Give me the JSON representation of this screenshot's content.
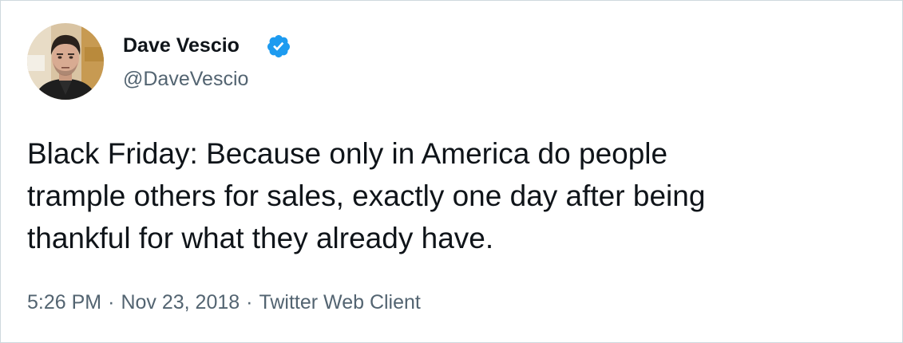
{
  "author": {
    "display_name": "Dave Vescio",
    "handle": "@DaveVescio",
    "verified": true,
    "verified_icon": "verified-badge-icon",
    "verified_color": "#1d9bf0"
  },
  "tweet": {
    "text_lines": [
      "Black Friday: Because only in America do people",
      "trample others for sales, exactly one day after being",
      "thankful for what they already have."
    ]
  },
  "meta": {
    "time": "5:26 PM",
    "separator": "·",
    "date": "Nov 23, 2018",
    "source": "Twitter Web Client"
  },
  "colors": {
    "text_primary": "#0f1419",
    "text_secondary": "#536471",
    "border": "#cfd9de"
  }
}
